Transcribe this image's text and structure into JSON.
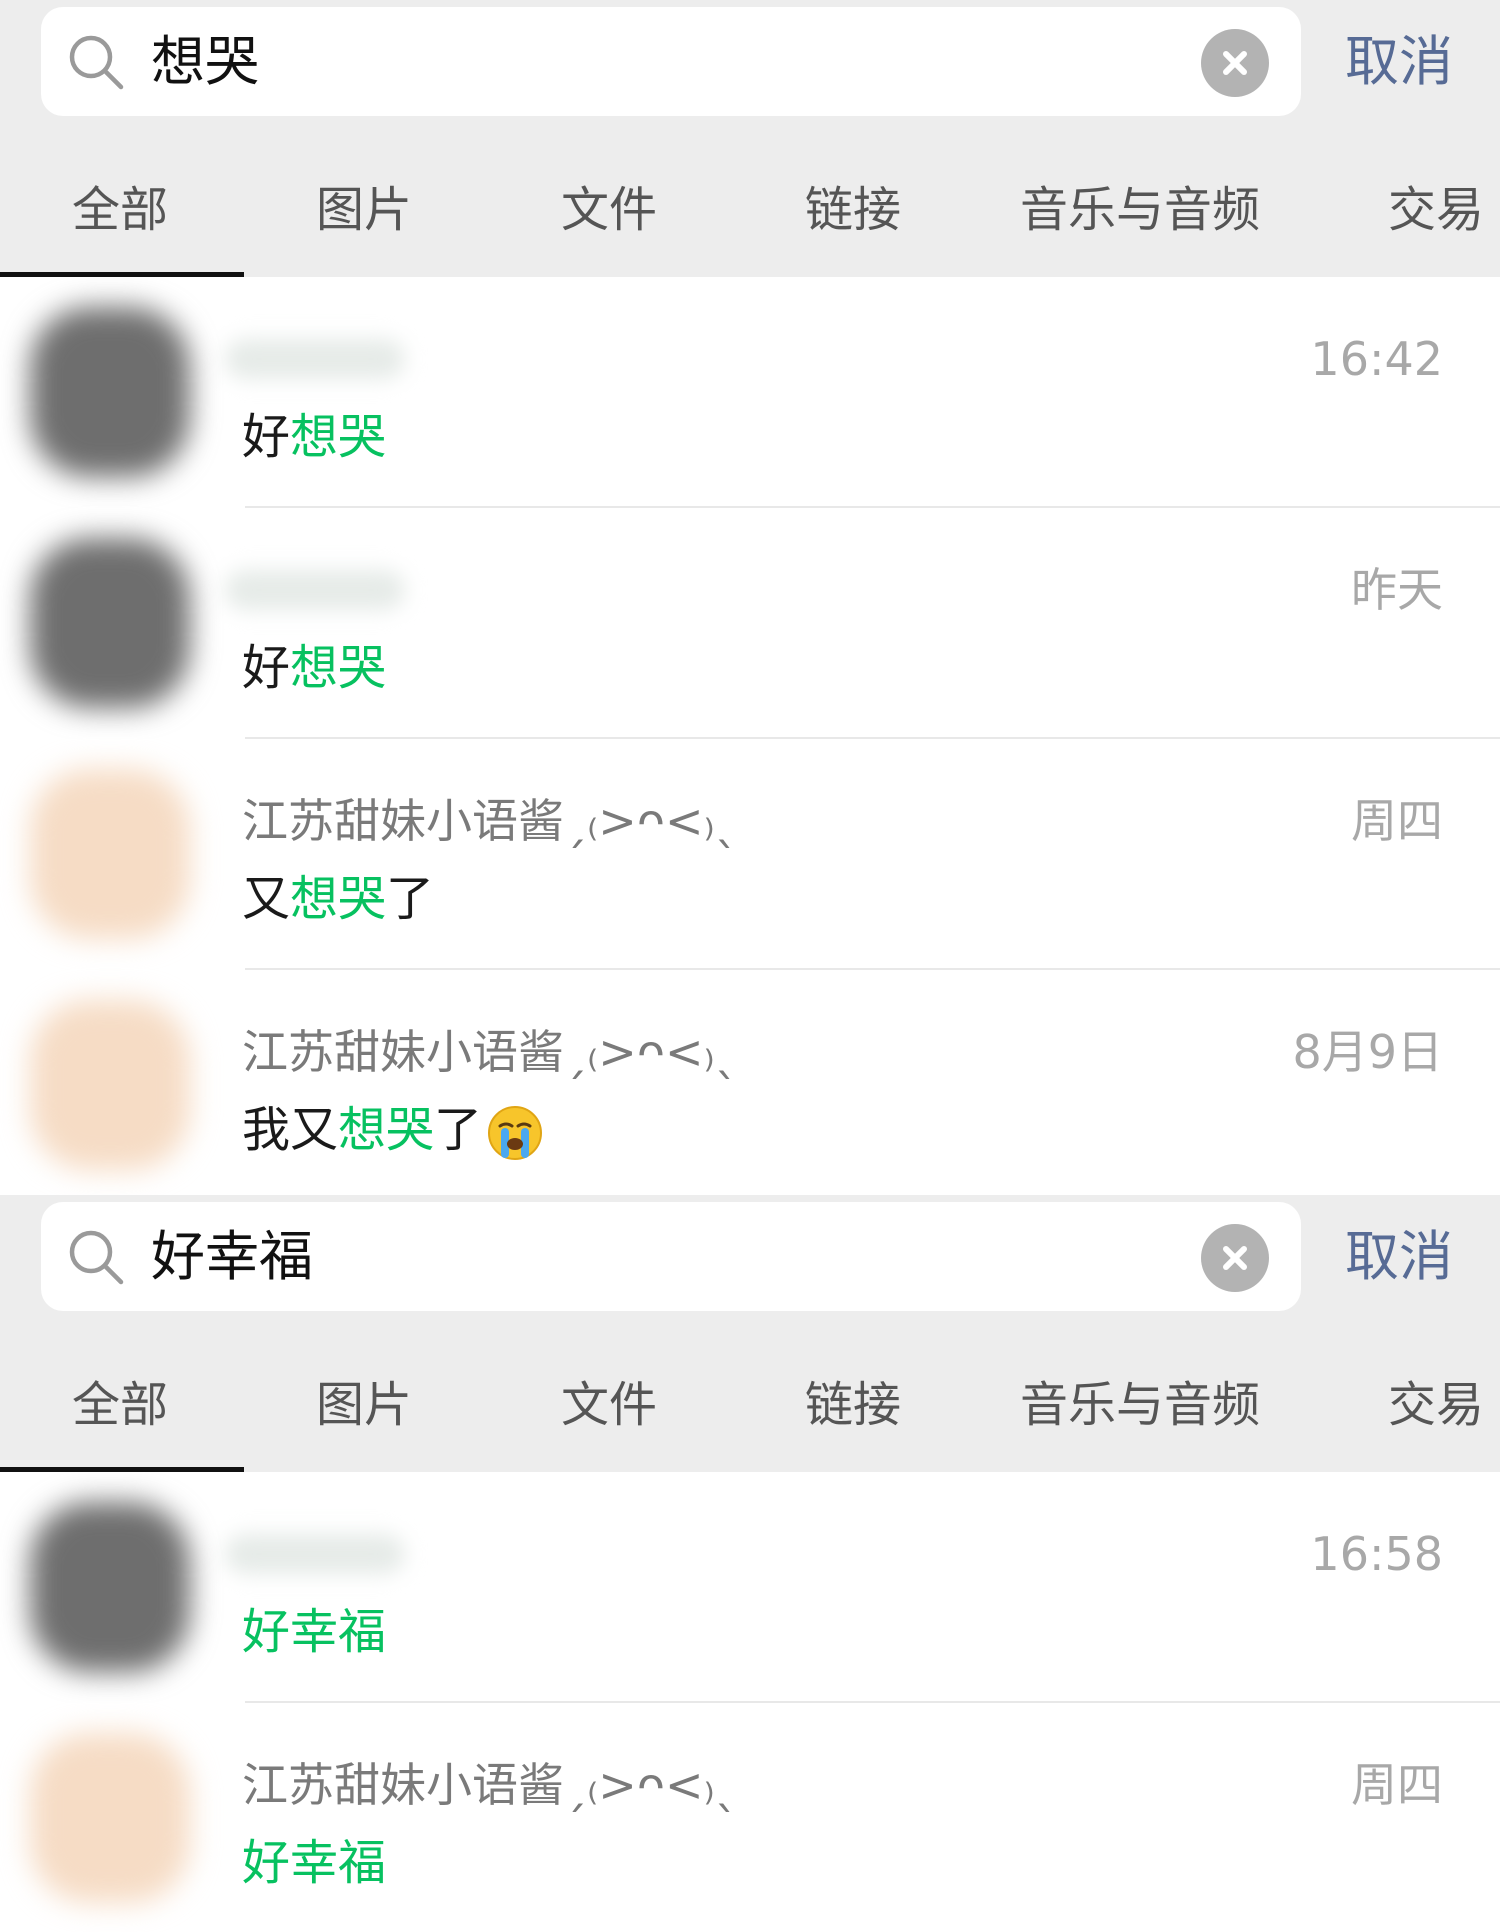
{
  "colors": {
    "highlight": "#07c160",
    "cancel": "#576b95",
    "background_bar": "#ededed",
    "time_text": "#a8a8a8",
    "name_text": "#7a7a7a"
  },
  "tabs": [
    "全部",
    "图片",
    "文件",
    "链接",
    "音乐与音频",
    "交易"
  ],
  "cancel_label": "取消",
  "searches": [
    {
      "query": "想哭",
      "active_tab": "全部",
      "results": [
        {
          "contact": "",
          "time": "16:42",
          "message": {
            "before": "好",
            "match": "想哭",
            "after": ""
          },
          "avatar": "dark"
        },
        {
          "contact": "",
          "time": "昨天",
          "message": {
            "before": "好",
            "match": "想哭",
            "after": ""
          },
          "avatar": "dark"
        },
        {
          "contact": "江苏甜妹小语酱ˏ₍>ᴖ<₎ˎ",
          "time": "周四",
          "message": {
            "before": "又",
            "match": "想哭",
            "after": "了"
          },
          "avatar": "peach"
        },
        {
          "contact": "江苏甜妹小语酱ˏ₍>ᴖ<₎ˎ",
          "time": "8月9日",
          "message": {
            "before": "我又",
            "match": "想哭",
            "after": "了"
          },
          "emoji": "loudly-crying-face",
          "avatar": "peach"
        }
      ]
    },
    {
      "query": "好幸福",
      "active_tab": "全部",
      "results": [
        {
          "contact": "",
          "time": "16:58",
          "message": {
            "before": "",
            "match": "好幸福",
            "after": ""
          },
          "avatar": "dark"
        },
        {
          "contact": "江苏甜妹小语酱ˏ₍>ᴖ<₎ˎ",
          "time": "周四",
          "message": {
            "before": "",
            "match": "好幸福",
            "after": ""
          },
          "avatar": "peach"
        }
      ]
    }
  ]
}
